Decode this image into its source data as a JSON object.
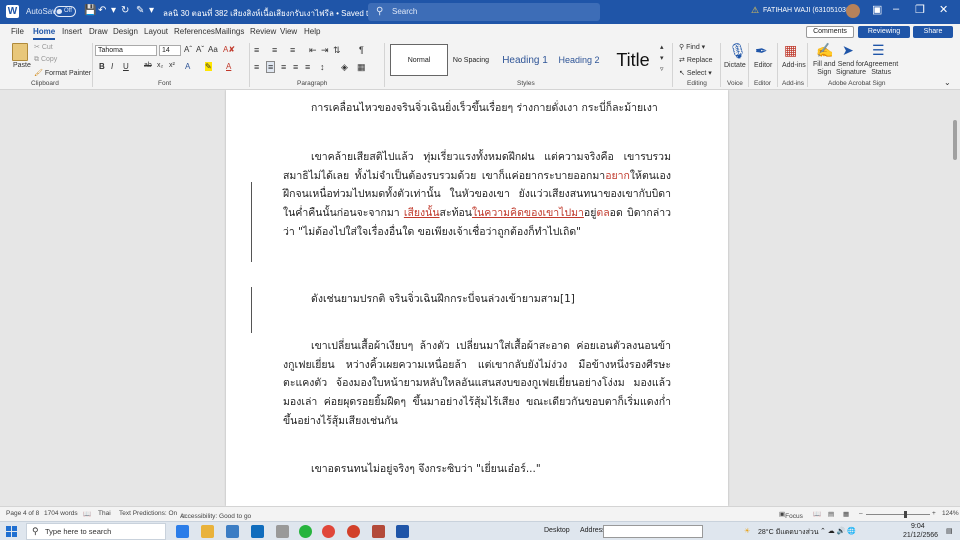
{
  "titlebar": {
    "autosave_label": "AutoSave",
    "autosave_state": "Off",
    "document_title": "ลลนิ 30 ตอนที่ 382 เสียงสิงห์เนื้อเสียงกรับเงาไฟรีล  •  Saved to this PC",
    "search_placeholder": "Search",
    "user_name": "FATIHAH WAJI (6310510363)"
  },
  "tabs": [
    "File",
    "Home",
    "Insert",
    "Draw",
    "Design",
    "Layout",
    "References",
    "Mailings",
    "Review",
    "View",
    "Help"
  ],
  "active_tab": "Home",
  "header_buttons": {
    "comments": "Comments",
    "reviewing": "Reviewing",
    "share": "Share"
  },
  "ribbon": {
    "clipboard": {
      "paste": "Paste",
      "cut": "Cut",
      "copy": "Copy",
      "format_painter": "Format Painter",
      "label": "Clipboard"
    },
    "font": {
      "font_name": "Tahoma",
      "font_size": "14",
      "label": "Font"
    },
    "paragraph": {
      "label": "Paragraph"
    },
    "styles": {
      "items": [
        "Normal",
        "No Spacing",
        "Heading 1",
        "Heading 2",
        "Title"
      ],
      "label": "Styles"
    },
    "editing": {
      "find": "Find",
      "replace": "Replace",
      "select": "Select",
      "label": "Editing"
    },
    "voice": {
      "dictate": "Dictate",
      "label": "Voice"
    },
    "editor": {
      "editor": "Editor",
      "label": "Editor"
    },
    "addins": {
      "addins": "Add-ins",
      "label": "Add-ins"
    },
    "acrobat": {
      "fill_sign_1": "Fill and",
      "fill_sign_2": "Sign",
      "send_sig_1": "Send for",
      "send_sig_2": "Signature",
      "agreement_1": "Agreement",
      "agreement_2": "Status",
      "label": "Adobe Acrobat Sign"
    }
  },
  "document": {
    "para1": "การเคลื่อนไหวของจรินจิ่วเฉินยิ่งเร็วขึ้นเรื่อยๆ ร่างกายดั่งเงา กระบี่ก็ละม้ายเงา",
    "para2_a": "เขาคล้ายเสียสติไปแล้ว ทุ่มเรี่ยวแรงทั้งหมดฝึกฝน แต่ความจริงคือ เขารบรวมสมาธิไม่ได้เลย ทั้งไม่จำเป็นต้องรบรวมด้วย เขาก็แค่อยากระบายออกมา",
    "para2_ins1": "อยาก",
    "para2_b": "ให้ตนเองฝึกจนเหนื่อท่วมไปหมดทั้งตัวเท่านั้น ในหัวของเขา ยังแว่วเสียงสนทนาของเขากับบิดาในค่ำคืนนั้นก่อนจะจากมา ",
    "para2_ins2": "เสียงนั้น",
    "para2_c": "สะท้อน",
    "para2_ins3": "ในความคิดของเขาไปมา",
    "para2_d": "อยู่",
    "para2_ins4": "ตล",
    "para2_e": "อด บิดากล่าวว่า \"ไม่ต้องไปใส่ใจเรื่องอื่นใด ขอเพียงเจ้าเชื่อว่าถูกต้องก็ทำไปเถิด\"",
    "para3": "ดังเช่นยามปรกติ จรินจิ่วเฉินฝึกกระบี่จนล่วงเข้ายามสาม[1]",
    "para4": "เขาเปลี่ยนเสื้อผ้าเงียบๆ ล้างตัว เปลี่ยนมาใส่เสื้อผ้าสะอาด ค่อยเอนตัวลงนอนข้างกูเฟยเยี่ยน หว่างคิ้วเผยความเหนื่อยล้า แต่เขากลับยังไม่ง่วง มือข้างหนึ่งรองศีรษะ ตะแคงตัว จ้องมองใบหน้ายามหลับใหลอันแสนสงบของกูเฟยเยี่ยนอย่างโง่งม มองแล้วมองเล่า ค่อยผุดรอยยิ้มฝืดๆ ขึ้นมาอย่างไร้สุ้มไร้เสียง ขณะเดียวกันขอบตาก็เริ่มแดงก่ำขึ้นอย่างไร้สุ้มเสียงเช่นกัน",
    "para5": "เขาอดรนทนไม่อยู่จริงๆ จึงกระซิบว่า \"เยี่ยนเอ๋อร์...\""
  },
  "statusbar": {
    "page": "Page 4 of 8",
    "words": "1704 words",
    "language": "Thai",
    "predictions": "Text Predictions: On",
    "accessibility": "Accessibility: Good to go",
    "focus": "Focus",
    "zoom": "124%"
  },
  "taskbar": {
    "search_placeholder": "Type here to search",
    "desktop_label": "Desktop",
    "address_label": "Address",
    "weather": "28°C มีแดดบางส่วน",
    "time": "9:04",
    "date": "21/12/2566"
  },
  "colors": {
    "word_blue": "#1f55a8",
    "tracked_change_red": "#c0392b"
  }
}
